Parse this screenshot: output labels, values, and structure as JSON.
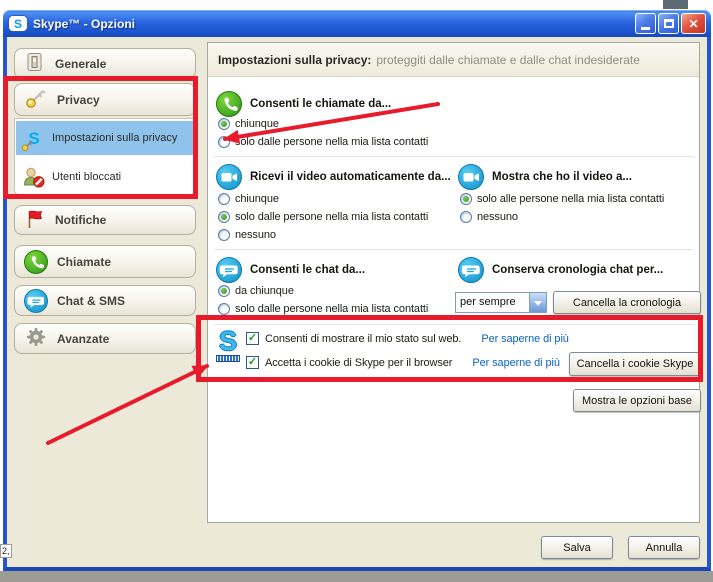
{
  "window": {
    "title": "Skype™ - Opzioni"
  },
  "icons": {
    "skype_letter": "S",
    "close_glyph": "✕",
    "check_glyph": "✓"
  },
  "sidebar": {
    "items": [
      {
        "label": "Generale",
        "icon": "switch-icon"
      },
      {
        "label": "Privacy",
        "icon": "keys-icon"
      },
      {
        "label": "Impostazioni sulla privacy",
        "icon": "skype-lock-icon",
        "selected": true
      },
      {
        "label": "Utenti bloccati",
        "icon": "blocked-user-icon"
      },
      {
        "label": "Notifiche",
        "icon": "flag-icon"
      },
      {
        "label": "Chiamate",
        "icon": "phone-icon"
      },
      {
        "label": "Chat & SMS",
        "icon": "chat-icon"
      },
      {
        "label": "Avanzate",
        "icon": "gear-icon"
      }
    ]
  },
  "header": {
    "title": "Impostazioni sulla privacy:",
    "subtitle": "proteggiti dalle chiamate e dalle chat indesiderate"
  },
  "sections": {
    "calls": {
      "title": "Consenti le chiamate da...",
      "options": [
        {
          "label": "chiunque",
          "selected": true
        },
        {
          "label": "solo dalle persone nella mia lista contatti",
          "selected": false
        }
      ]
    },
    "video_receive": {
      "title": "Ricevi il video automaticamente da...",
      "options": [
        {
          "label": "chiunque",
          "selected": false
        },
        {
          "label": "solo dalle persone nella mia lista contatti",
          "selected": true
        },
        {
          "label": "nessuno",
          "selected": false
        }
      ]
    },
    "video_show": {
      "title": "Mostra che ho il video a...",
      "options": [
        {
          "label": "solo alle persone nella mia lista contatti",
          "selected": true
        },
        {
          "label": "nessuno",
          "selected": false
        }
      ]
    },
    "chat": {
      "title": "Consenti le chat da...",
      "options": [
        {
          "label": "da chiunque",
          "selected": true
        },
        {
          "label": "solo dalle persone nella mia lista contatti",
          "selected": false
        }
      ]
    },
    "history": {
      "title": "Conserva cronologia chat per...",
      "selected_value": "per sempre",
      "clear_history_button": "Cancella la cronologia"
    },
    "web": {
      "status_checkbox": {
        "label": "Consenti di mostrare il mio stato sul web.",
        "checked": true,
        "link": "Per saperne di più"
      },
      "cookies_checkbox": {
        "label": "Accetta i cookie di Skype per il browser",
        "checked": true,
        "link": "Per saperne di più"
      },
      "clear_cookies_button": "Cancella i cookie Skype"
    }
  },
  "footer": {
    "show_basic_button": "Mostra le opzioni base",
    "save_button": "Salva",
    "cancel_button": "Annulla"
  },
  "background": {
    "artifact_text": "2,"
  },
  "colors": {
    "annotation_red": "#E81B2D",
    "selected_item_blue": "#8FC3EC",
    "link_blue": "#0B63C5",
    "skype_blue": "#00AFF0",
    "dialog_beige": "#ECE9D8"
  }
}
